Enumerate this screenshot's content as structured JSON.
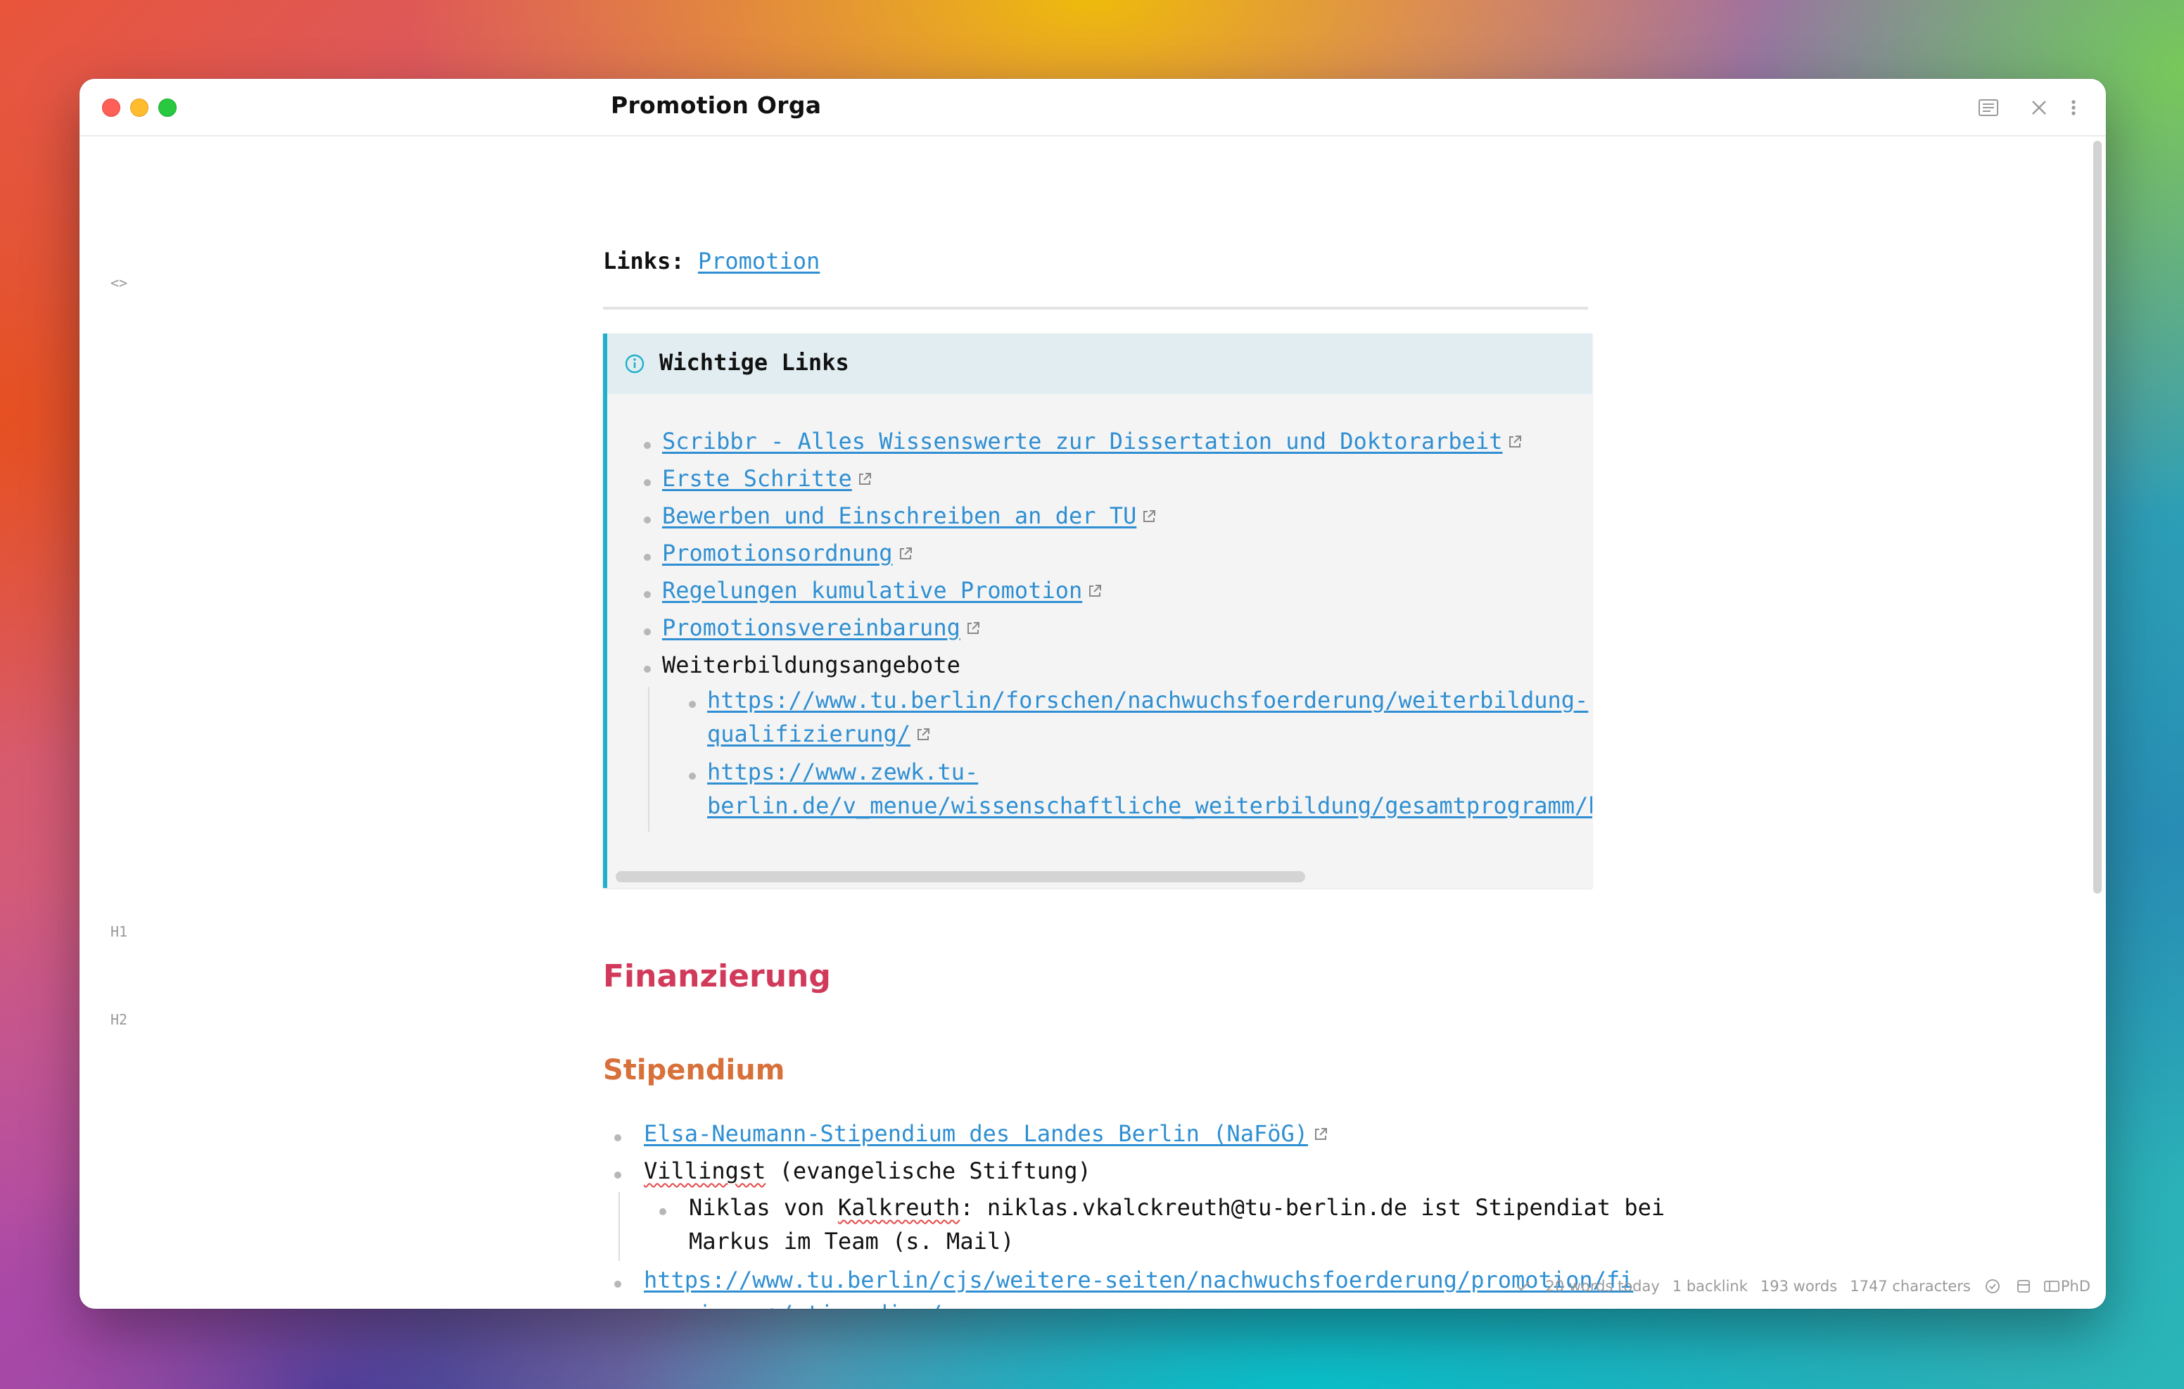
{
  "window": {
    "title": "Promotion Orga"
  },
  "gutter": {
    "code_toggle": "<>",
    "h1_marker": "H1",
    "h2_marker": "H2"
  },
  "links": {
    "label": "Links:",
    "link": "Promotion"
  },
  "callout": {
    "title": "Wichtige Links",
    "items": [
      {
        "text": "Scribbr - Alles Wissenswerte zur Dissertation und Doktorarbeit",
        "external": true
      },
      {
        "text": "Erste Schritte",
        "external": true
      },
      {
        "text": "Bewerben und Einschreiben an der TU",
        "external": true
      },
      {
        "text": "Promotionsordnung",
        "external": true
      },
      {
        "text": "Regelungen kumulative Promotion",
        "external": true
      },
      {
        "text": "Promotionsvereinbarung",
        "external": true
      },
      {
        "text": "Weiterbildungsangebote",
        "external": false
      }
    ],
    "sub_items": [
      {
        "line1": "https://www.tu.berlin/forschen/nachwuchsfoerderung/weiterbildung-",
        "line2": "qualifizierung/"
      },
      {
        "line1": "https://www.zewk.tu-",
        "line2": "berlin.de/v_menue/wissenschaftliche_weiterbildung/gesamtprogramm/ber"
      }
    ]
  },
  "finanzierung": {
    "h1": "Finanzierung",
    "h2": "Stipendium",
    "item1": "Elsa-Neumann-Stipendium des Landes Berlin (NaFöG)",
    "item2_word": "Villingst",
    "item2_rest": " (evangelische Stiftung)",
    "sub_pre": "Niklas von ",
    "sub_word": "Kalkreuth",
    "sub_line1_rest": ": niklas.vkalckreuth@tu-berlin.de ist Stipendiat bei",
    "sub_line2": "Markus im Team (s. Mail)",
    "item3_line1": "https://www.tu.berlin/cjs/weitere-seiten/nachwuchsfoerderung/promotion/fi",
    "item3_line2": "nanzierung/stipendien/"
  },
  "status_bar": {
    "words_today": "20 words today",
    "backlinks": "1 backlink",
    "words": "193 words",
    "characters": "1747 characters",
    "vault": "PhD"
  },
  "colors": {
    "accent_link": "#2f8fd2",
    "callout_border": "#1eb1c9",
    "h1": "#d13a5a",
    "h2": "#d8703a"
  }
}
